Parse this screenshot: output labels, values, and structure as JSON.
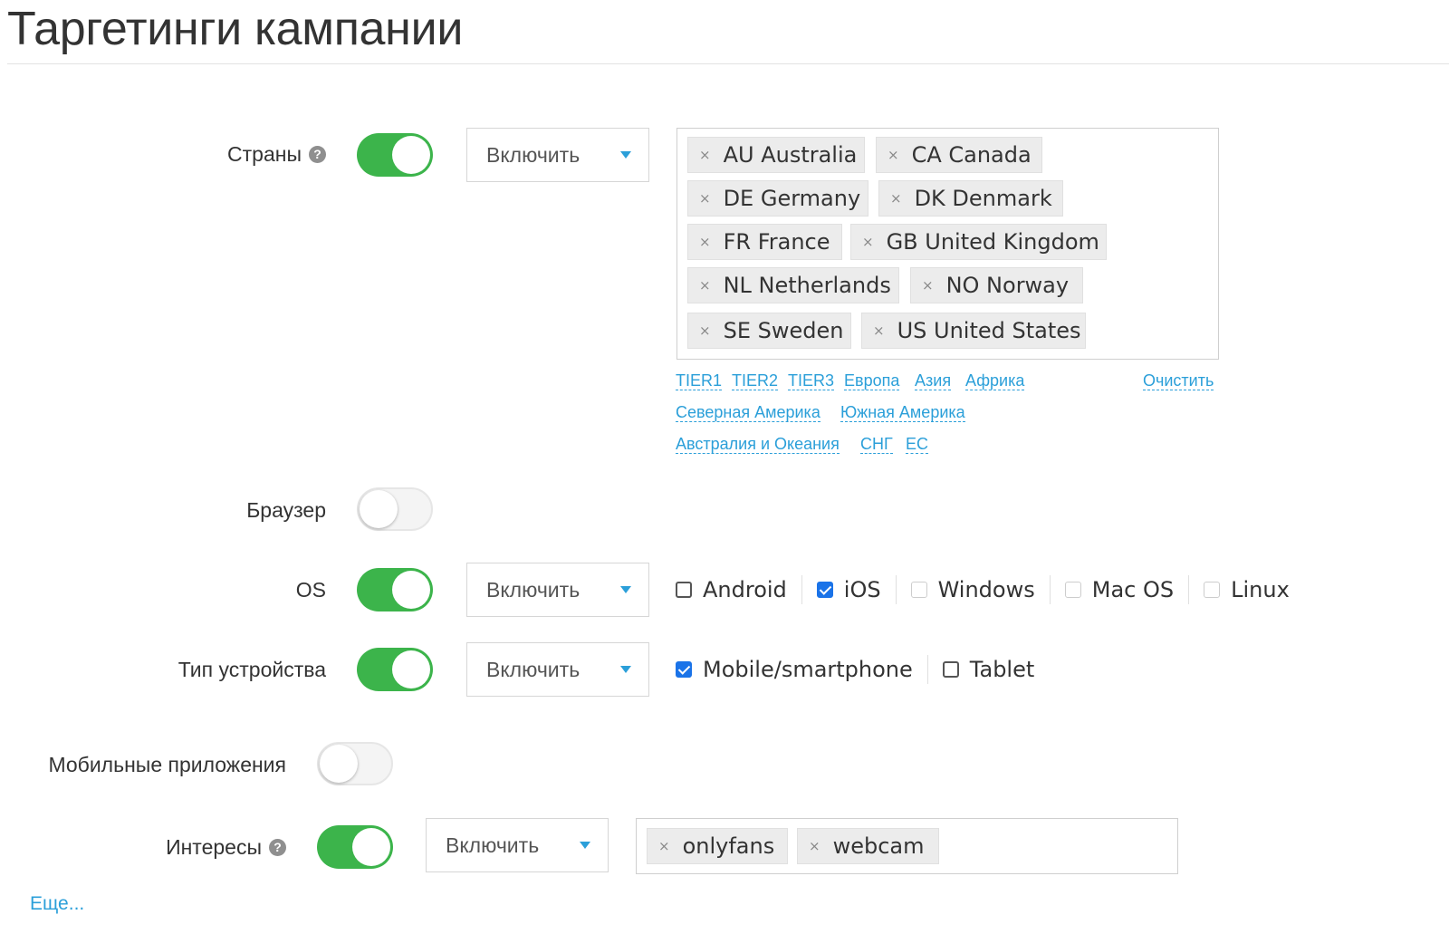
{
  "page": {
    "title": "Таргетинги кампании"
  },
  "countries": {
    "label": "Страны",
    "help_icon": "?",
    "enabled": true,
    "mode": "Включить",
    "tags": [
      {
        "label": "AU Australia"
      },
      {
        "label": "CA Canada"
      },
      {
        "label": "DE Germany"
      },
      {
        "label": "DK Denmark"
      },
      {
        "label": "FR France"
      },
      {
        "label": "GB United Kingdom"
      },
      {
        "label": "NL Netherlands"
      },
      {
        "label": "NO Norway"
      },
      {
        "label": "SE Sweden"
      },
      {
        "label": "US United States"
      }
    ],
    "remove_glyph": "×",
    "quick_links": {
      "tier1": "TIER1",
      "tier2": "TIER2",
      "tier3": "TIER3",
      "europe": "Европа",
      "asia": "Азия",
      "africa": "Африка",
      "north_america": "Северная Америка",
      "south_america": "Южная Америка",
      "australia_oceania": "Австралия и Океания",
      "cis": "СНГ",
      "eu": "ЕС"
    },
    "clear_label": "Очистить"
  },
  "browser": {
    "label": "Браузер",
    "enabled": false
  },
  "os": {
    "label": "OS",
    "enabled": true,
    "mode": "Включить",
    "options": [
      {
        "label": "Android",
        "checked": false
      },
      {
        "label": "iOS",
        "checked": true
      },
      {
        "label": "Windows",
        "checked": false
      },
      {
        "label": "Mac OS",
        "checked": false
      },
      {
        "label": "Linux",
        "checked": false
      }
    ]
  },
  "device_type": {
    "label": "Тип устройства",
    "enabled": true,
    "mode": "Включить",
    "options": [
      {
        "label": "Mobile/smartphone",
        "checked": true
      },
      {
        "label": "Tablet",
        "checked": false
      }
    ]
  },
  "mobile_apps": {
    "label": "Мобильные приложения",
    "enabled": false
  },
  "interests": {
    "label": "Интересы",
    "help_icon": "?",
    "enabled": true,
    "mode": "Включить",
    "tags": [
      {
        "label": "onlyfans"
      },
      {
        "label": "webcam"
      }
    ]
  },
  "more_link": "Еще...",
  "colors": {
    "toggle_on": "#3cb44b",
    "link": "#2b9fd9",
    "checkbox": "#1a73e8"
  }
}
